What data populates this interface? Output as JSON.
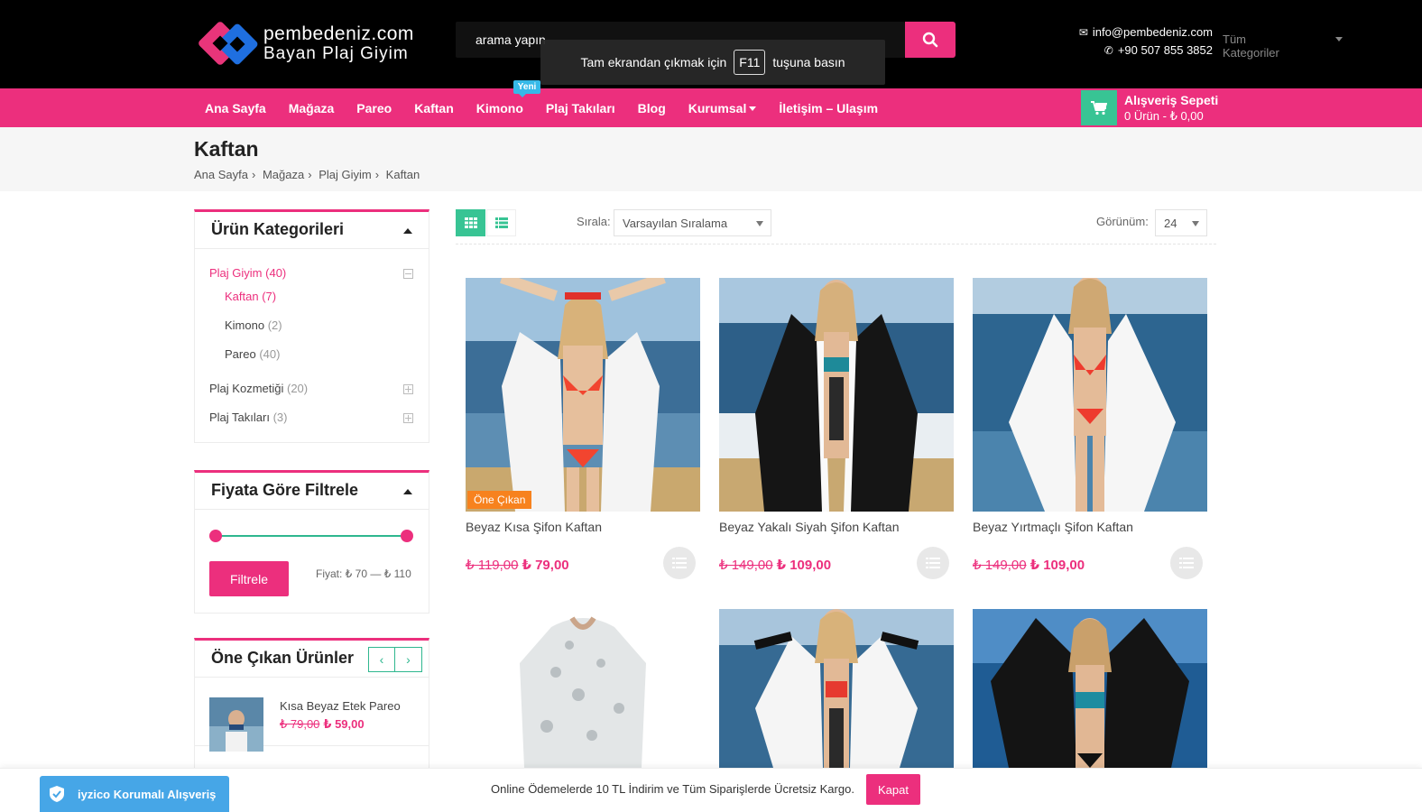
{
  "header": {
    "logo_line1": "pembedeniz.com",
    "logo_line2": "Bayan Plaj Giyim",
    "search_placeholder": "arama yapın",
    "category_select": "Tüm Kategoriler",
    "email": "info@pembedeniz.com",
    "phone": "+90 507 855 3852"
  },
  "fullscreen_hint": {
    "before": "Tam ekrandan çıkmak için",
    "key": "F11",
    "after": "tuşuna basın"
  },
  "nav": {
    "items": [
      {
        "label": "Ana Sayfa"
      },
      {
        "label": "Mağaza"
      },
      {
        "label": "Pareo"
      },
      {
        "label": "Kaftan"
      },
      {
        "label": "Kimono",
        "badge": "Yeni"
      },
      {
        "label": "Plaj Takıları"
      },
      {
        "label": "Blog"
      },
      {
        "label": "Kurumsal"
      },
      {
        "label": "İletişim – Ulaşım"
      }
    ],
    "cart_title": "Alışveriş Sepeti",
    "cart_summary": "0 Ürün - ₺ 0,00"
  },
  "page": {
    "title": "Kaftan",
    "breadcrumb": [
      "Ana Sayfa",
      "Mağaza",
      "Plaj Giyim",
      "Kaftan"
    ]
  },
  "sidebar": {
    "categories_title": "Ürün Kategorileri",
    "categories": [
      {
        "name": "Plaj Giyim",
        "count": "(40)"
      },
      {
        "name": "Kaftan",
        "count": "(7)"
      },
      {
        "name": "Kimono",
        "count": "(2)"
      },
      {
        "name": "Pareo",
        "count": "(40)"
      },
      {
        "name": "Plaj Kozmetiği",
        "count": "(20)"
      },
      {
        "name": "Plaj Takıları",
        "count": "(3)"
      }
    ],
    "price_title": "Fiyata Göre Filtrele",
    "filter_button": "Filtrele",
    "price_range": "Fiyat: ₺ 70 — ₺ 110",
    "featured_title": "Öne Çıkan Ürünler",
    "featured": [
      {
        "name": "Kısa Beyaz Etek Pareo",
        "old_price": "₺ 79,00",
        "price": "₺ 59,00"
      }
    ]
  },
  "toolbar": {
    "sort_label": "Sırala:",
    "sort_value": "Varsayılan Sıralama",
    "view_label": "Görünüm:",
    "view_value": "24"
  },
  "products": [
    {
      "name": "Beyaz Kısa Şifon Kaftan",
      "old_price": "₺ 119,00",
      "price": "₺ 79,00",
      "badge": "Öne Çıkan"
    },
    {
      "name": "Beyaz Yakalı Siyah Şifon Kaftan",
      "old_price": "₺ 149,00",
      "price": "₺ 109,00"
    },
    {
      "name": "Beyaz Yırtmaçlı Şifon Kaftan",
      "old_price": "₺ 149,00",
      "price": "₺ 109,00"
    }
  ],
  "bottom": {
    "notice": "Online Ödemelerde 10 TL İndirim ve Tüm Siparişlerde Ücretsiz Kargo.",
    "close": "Kapat",
    "iyzico": "iyzico Korumalı Alışveriş"
  },
  "colors": {
    "brand_pink": "#ec2f7d",
    "accent_green": "#2fb78f",
    "cart_green": "#38c494",
    "featured_orange": "#f7821e",
    "iyzico_blue": "#46a6e7"
  }
}
